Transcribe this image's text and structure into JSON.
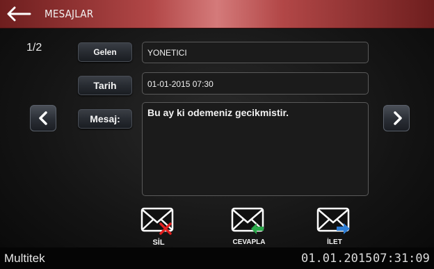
{
  "header": {
    "title": "MESAJLAR"
  },
  "message": {
    "page_indicator": "1/2",
    "sender_label": "Gelen",
    "sender_value": "YONETICI",
    "date_label": "Tarih",
    "date_value": "01-01-2015 07:30",
    "body_label": "Mesaj:",
    "body_value": "Bu ay ki odemeniz gecikmistir."
  },
  "actions": {
    "delete_label": "SİL",
    "reply_label": "CEVAPLA",
    "forward_label": "İLET"
  },
  "footer": {
    "brand": "Multitek",
    "date": "01.01.2015",
    "time": "07:31:09"
  },
  "colors": {
    "header_red": "#b24747",
    "delete_x": "#e02020",
    "reply_arrow": "#2aa84a",
    "forward_arrow": "#2f7fd6"
  }
}
